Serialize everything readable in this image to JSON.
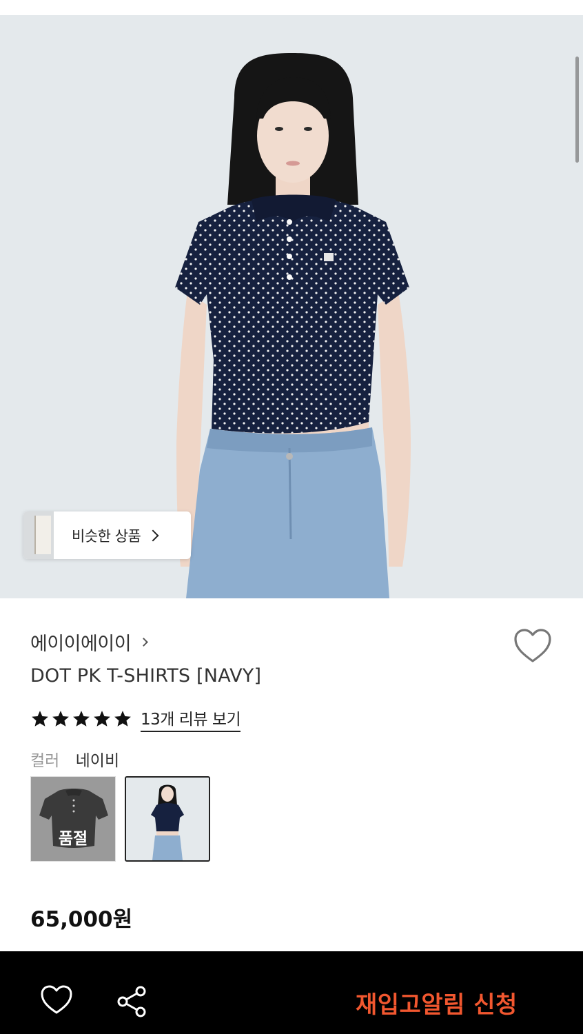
{
  "similar": {
    "label": "비슷한 상품"
  },
  "product": {
    "brand": "에이이에이이",
    "title": "DOT PK T-SHIRTS [NAVY]",
    "rating_stars": 5,
    "review_link": "13개 리뷰 보기",
    "color_label": "컬러",
    "color_value": "네이비",
    "swatches": [
      {
        "status": "품절"
      },
      {
        "status": "selected"
      }
    ],
    "price": "65,000원"
  },
  "bottom_bar": {
    "restock_label": "재입고알림 신청"
  },
  "colors": {
    "accent": "#f1572f",
    "bar": "#000000",
    "shirt": "#16213f",
    "jeans": "#8eaecf",
    "background": "#e4e9ec"
  },
  "icons": [
    "heart-icon",
    "share-icon",
    "star-icon",
    "chevron-right-icon"
  ]
}
